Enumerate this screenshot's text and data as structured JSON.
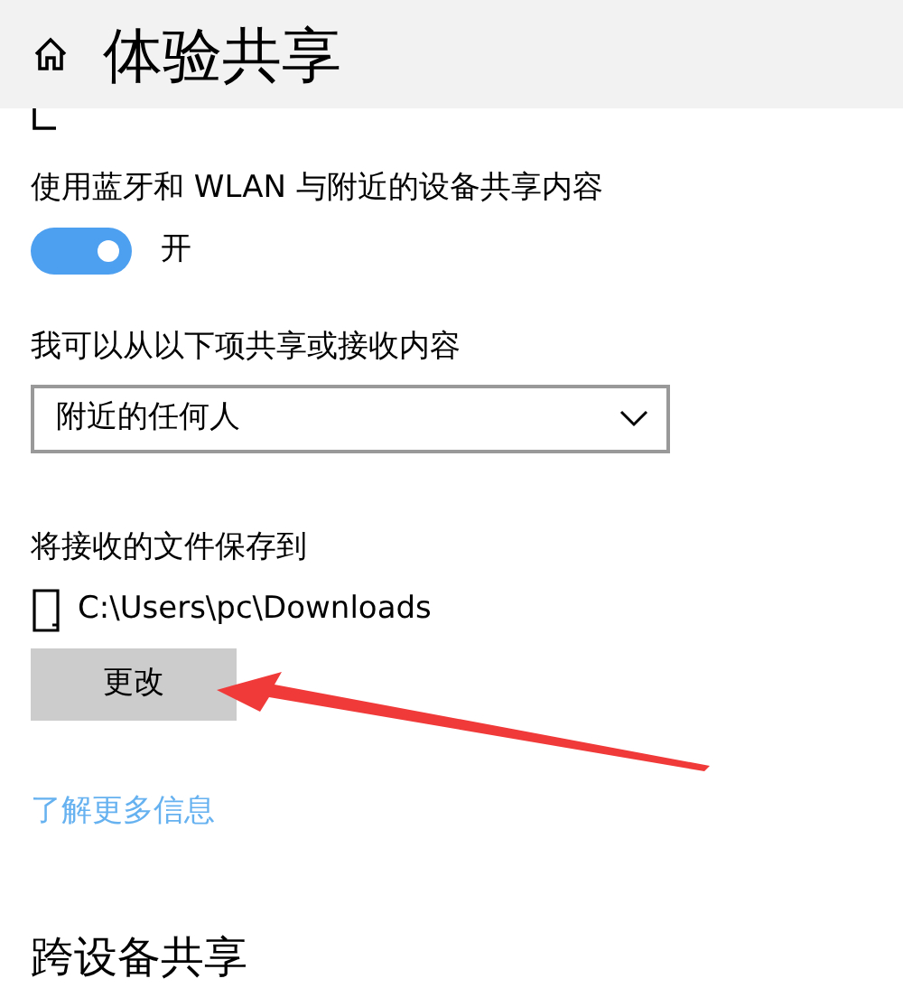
{
  "header": {
    "title": "体验共享"
  },
  "nearby": {
    "description": "使用蓝牙和 WLAN 与附近的设备共享内容",
    "toggle": {
      "on": true,
      "label": "开"
    }
  },
  "share_with": {
    "label": "我可以从以下项共享或接收内容",
    "dropdown": {
      "value": "附近的任何人"
    }
  },
  "save_to": {
    "label": "将接收的文件保存到",
    "path": "C:\\Users\\pc\\Downloads",
    "button": "更改"
  },
  "link": "了解更多信息",
  "next_section": {
    "title": "跨设备共享"
  },
  "annotation": {
    "kind": "arrow"
  }
}
